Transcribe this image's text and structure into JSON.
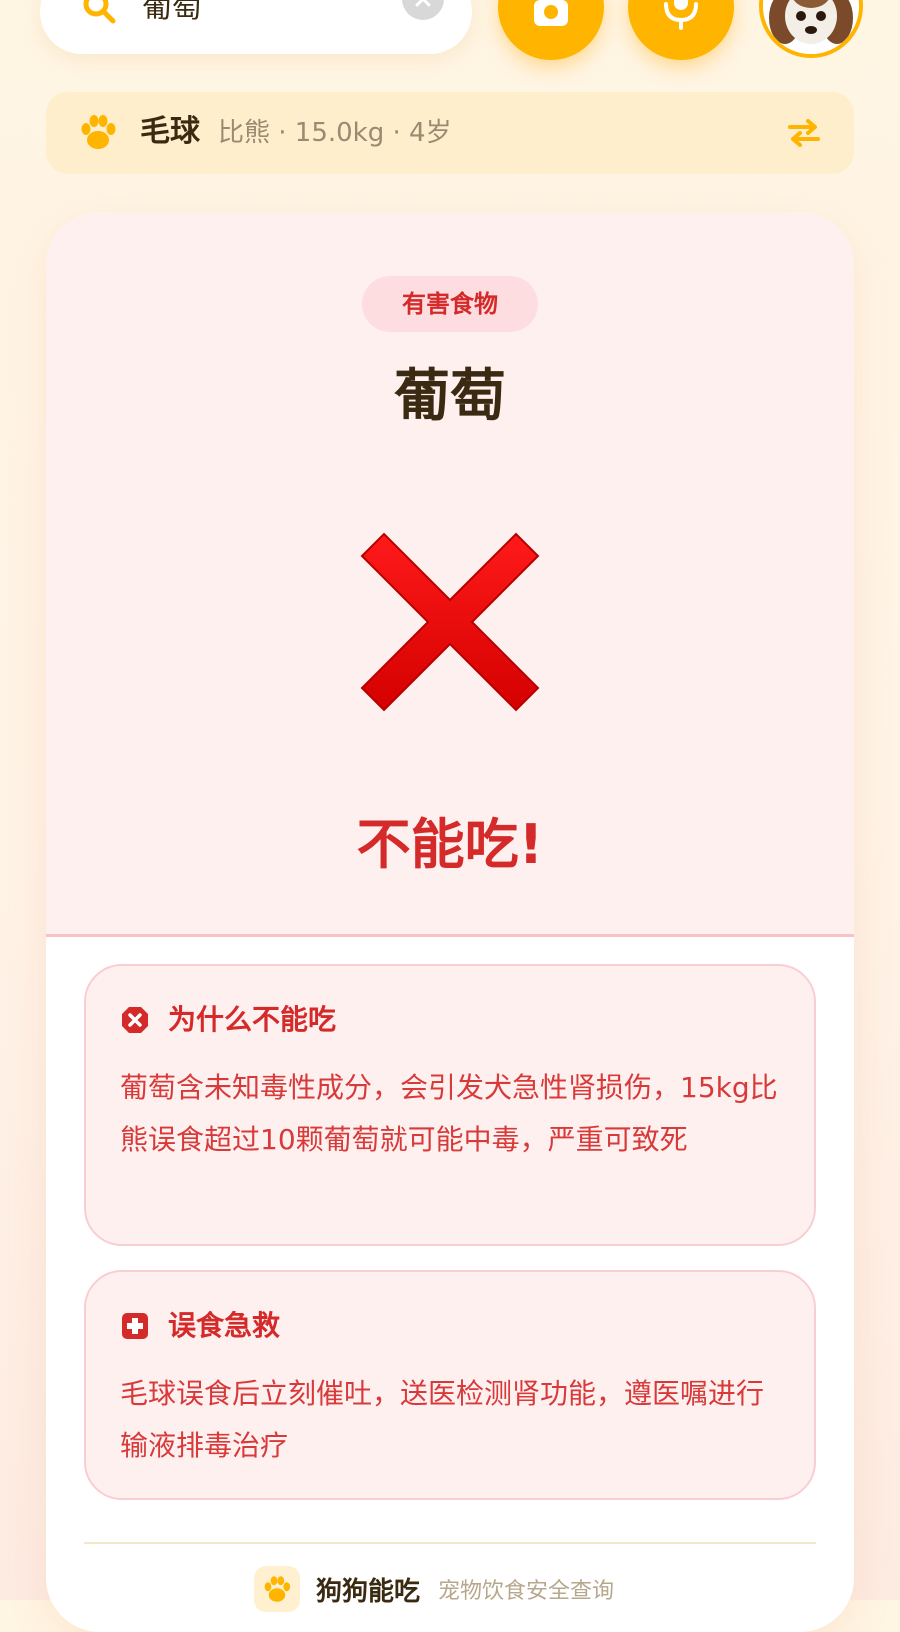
{
  "search": {
    "query": "葡萄"
  },
  "pet": {
    "name": "毛球",
    "meta": "比熊 · 15.0kg · 4岁"
  },
  "result": {
    "badge": "有害食物",
    "food_name": "葡萄",
    "verdict": "不能吃!",
    "status_color": "#d42a2a"
  },
  "why": {
    "title": "为什么不能吃",
    "body": "葡萄含未知毒性成分，会引发犬急性肾损伤，15kg比熊误食超过10颗葡萄就可能中毒，严重可致死"
  },
  "first_aid": {
    "title": "误食急救",
    "body": "毛球误食后立刻催吐，送医检测肾功能，遵医嘱进行输液排毒治疗"
  },
  "footer": {
    "app_name": "狗狗能吃",
    "tagline": "宠物饮食安全查询"
  },
  "icons": [
    "search-icon",
    "clear-icon",
    "camera-icon",
    "mic-icon",
    "avatar",
    "paw-icon",
    "switch-icon",
    "cross-icon",
    "error-circle-icon",
    "first-aid-icon"
  ],
  "colors": {
    "accent": "#ffb400",
    "danger": "#d42a2a",
    "text_dark": "#3b2a12"
  }
}
